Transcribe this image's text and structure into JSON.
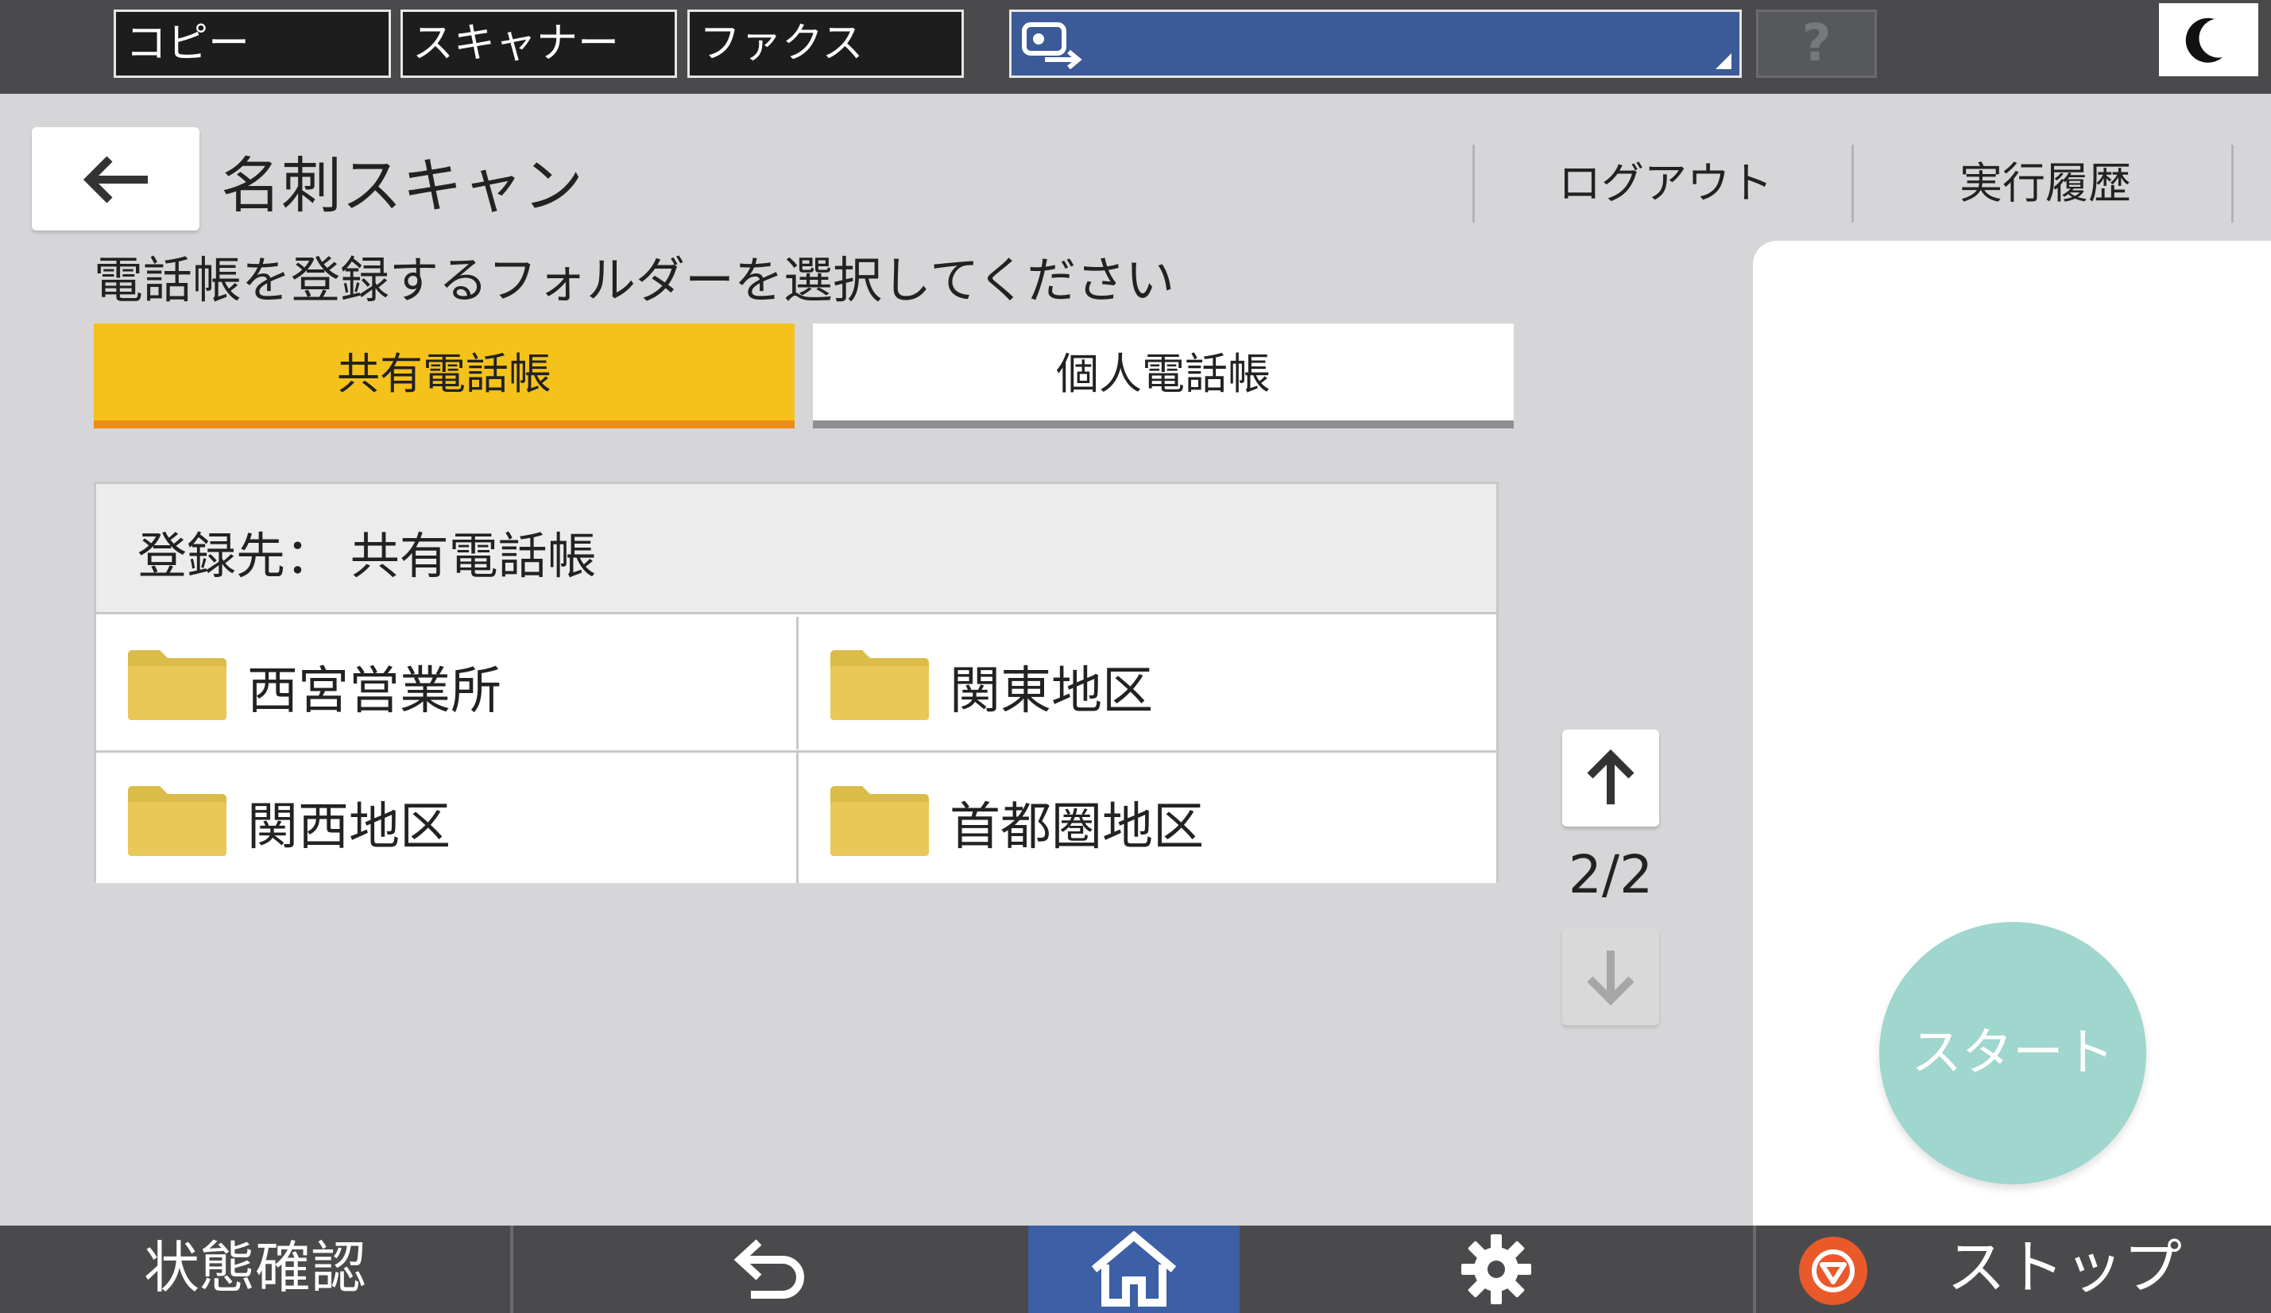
{
  "top_bar": {
    "app_tabs": [
      "コピー",
      "スキャナー",
      "ファクス"
    ],
    "help_label": "?",
    "icons": {
      "function": "screen-transfer-icon",
      "sleep": "moon-icon"
    }
  },
  "header": {
    "title": "名刺スキャン",
    "logout_label": "ログアウト",
    "history_label": "実行履歴",
    "back_icon": "arrow-left-icon"
  },
  "instruction": "電話帳を登録するフォルダーを選択してください",
  "phonebook_tabs": {
    "shared": "共有電話帳",
    "personal": "個人電話帳",
    "selected": "共有電話帳",
    "colors": {
      "selected_bg": "#f5c21b",
      "selected_underline": "#ee8a16"
    }
  },
  "panel": {
    "header": "登録先： 共有電話帳",
    "folders": [
      "西宮営業所",
      "関東地区",
      "関西地区",
      "首都圏地区"
    ]
  },
  "pager": {
    "page": "2/2",
    "up_icon": "arrow-up-icon",
    "down_icon": "arrow-down-icon",
    "down_enabled": false
  },
  "start_button": {
    "label": "スタート",
    "enabled": false,
    "color": "#9fd6cd"
  },
  "bottom_bar": {
    "status_label": "状態確認",
    "stop_label": "ストップ",
    "icons": {
      "back": "undo-arrow-icon",
      "home": "home-icon",
      "settings": "gear-icon",
      "stop": "stop-icon"
    },
    "colors": {
      "home_bg": "#3c5fa6",
      "stop": "#e9592a"
    }
  }
}
